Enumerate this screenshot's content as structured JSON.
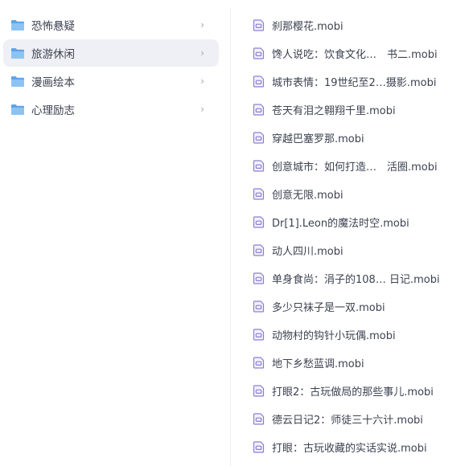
{
  "colors": {
    "folder_blue": "#5ea4e8",
    "folder_blue_light": "#8cc3f3",
    "mobi_icon": "#8b7fd6",
    "selected_bg": "#eef0f5"
  },
  "folders": [
    {
      "label": "恐怖悬疑",
      "icon": "folder-icon",
      "selected": false
    },
    {
      "label": "旅游休闲",
      "icon": "folder-icon",
      "selected": true
    },
    {
      "label": "漫画绘本",
      "icon": "folder-icon",
      "selected": false
    },
    {
      "label": "心理励志",
      "icon": "folder-icon",
      "selected": false
    }
  ],
  "files": [
    {
      "name": "刹那樱花.mobi",
      "icon": "mobi-file-icon"
    },
    {
      "name": "馋人说吃：饮食文化…　书二.mobi",
      "icon": "mobi-file-icon"
    },
    {
      "name": "城市表情：19世纪至2…摄影.mobi",
      "icon": "mobi-file-icon"
    },
    {
      "name": "苍天有泪之翱翔千里.mobi",
      "icon": "mobi-file-icon"
    },
    {
      "name": "穿越巴塞罗那.mobi",
      "icon": "mobi-file-icon"
    },
    {
      "name": "创意城市：如何打造…　活圈.mobi",
      "icon": "mobi-file-icon"
    },
    {
      "name": "创意无限.mobi",
      "icon": "mobi-file-icon"
    },
    {
      "name": "Dr[1].Leon的魔法时空.mobi",
      "icon": "mobi-file-icon"
    },
    {
      "name": "动人四川.mobi",
      "icon": "mobi-file-icon"
    },
    {
      "name": "单身食尚：涓子的108… 日记.mobi",
      "icon": "mobi-file-icon"
    },
    {
      "name": "多少只袜子是一双.mobi",
      "icon": "mobi-file-icon"
    },
    {
      "name": "动物村的钩针小玩偶.mobi",
      "icon": "mobi-file-icon"
    },
    {
      "name": "地下乡愁蓝调.mobi",
      "icon": "mobi-file-icon"
    },
    {
      "name": "打眼2：古玩做局的那些事儿.mobi",
      "icon": "mobi-file-icon"
    },
    {
      "name": "德云日记2：师徒三十六计.mobi",
      "icon": "mobi-file-icon"
    },
    {
      "name": "打眼：古玩收藏的实话实说.mobi",
      "icon": "mobi-file-icon"
    }
  ]
}
